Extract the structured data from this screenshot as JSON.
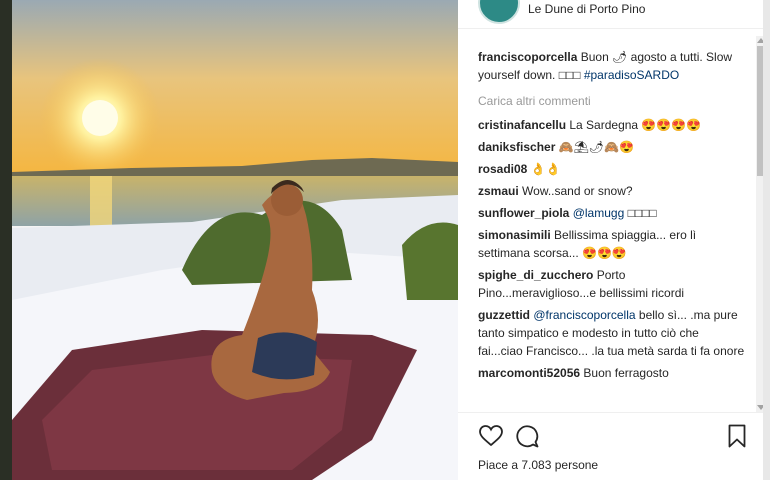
{
  "location": "Le Dune di Porto Pino",
  "caption": {
    "user": "franciscoporcella",
    "text_before": "Buon ",
    "emoji": "🌶",
    "text_after": "agosto a tutti. Slow yourself down. ",
    "squares": "□□□",
    "hashtag": "#paradisoSARDO"
  },
  "load_more": "Carica altri commenti",
  "comments": [
    {
      "user": "cristinafancellu",
      "text": "La Sardegna 😍😍😍😍"
    },
    {
      "user": "daniksfischer",
      "text": "🙈⛱🌶🙈😍"
    },
    {
      "user": "rosadi08",
      "text": "👌👌"
    },
    {
      "user": "zsmaui",
      "text": "Wow..sand or snow?"
    },
    {
      "user": "sunflower_piola",
      "mention": "@lamugg",
      "text": "□□□□"
    },
    {
      "user": "simonasimili",
      "text": "Bellissima spiaggia... ero lì settimana scorsa... 😍😍😍"
    },
    {
      "user": "spighe_di_zucchero",
      "text": "Porto Pino...meraviglioso...e bellissimi ricordi"
    },
    {
      "user": "guzzettid",
      "mention": "@franciscoporcella",
      "text": "bello sì... .ma pure tanto simpatico e modesto in tutto ciò che fai...ciao Francisco... .la tua metà sarda ti fa onore"
    },
    {
      "user": "marcomonti52056",
      "text": "Buon ferragosto"
    }
  ],
  "likes": "Piace a 7.083 persone"
}
